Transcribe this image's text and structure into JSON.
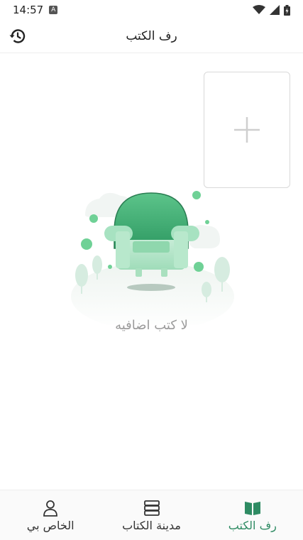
{
  "status_bar": {
    "time": "14:57",
    "notification_icon": "A"
  },
  "app_bar": {
    "title": "رف الكتب",
    "history_icon": "history-icon"
  },
  "add_card": {
    "icon": "plus-icon"
  },
  "empty_state": {
    "message": "لا كتب اضافيه"
  },
  "bottom_nav": {
    "items": [
      {
        "label": "رف الكتب",
        "icon": "open-book-icon",
        "active": true
      },
      {
        "label": "مدينة الكتاب",
        "icon": "stack-icon",
        "active": false
      },
      {
        "label": "الخاص بي",
        "icon": "person-icon",
        "active": false
      }
    ]
  },
  "colors": {
    "accent": "#2e8b63",
    "illustration_green": "#5cc48a"
  }
}
